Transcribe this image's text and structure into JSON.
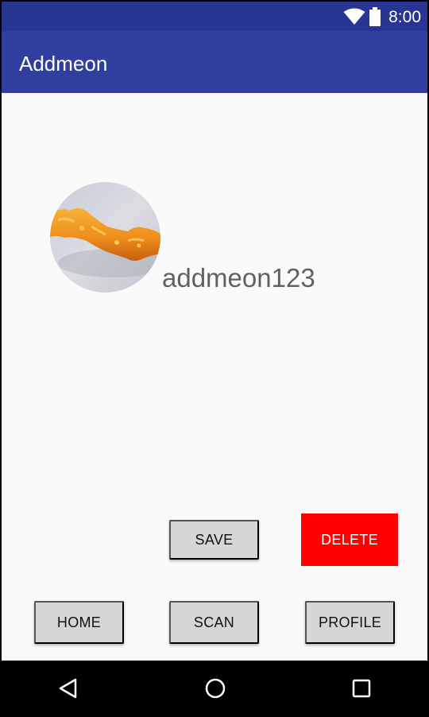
{
  "status_bar": {
    "time": "8:00",
    "icons": [
      "wifi-icon",
      "battery-icon"
    ]
  },
  "app_bar": {
    "title": "Addmeon"
  },
  "profile": {
    "avatar_icon": "cheese-puff-photo",
    "username": "addmeon123"
  },
  "actions": {
    "save_label": "SAVE",
    "delete_label": "DELETE"
  },
  "bottom_nav": {
    "home_label": "HOME",
    "scan_label": "SCAN",
    "profile_label": "PROFILE"
  },
  "system_nav": {
    "icons": [
      "back-icon",
      "home-circle-icon",
      "recents-icon"
    ]
  },
  "colors": {
    "status_bar": "#283593",
    "app_bar": "#303f9f",
    "delete_button": "#ff0000",
    "button_gray": "#d6d6d6",
    "background": "#fafafa"
  }
}
